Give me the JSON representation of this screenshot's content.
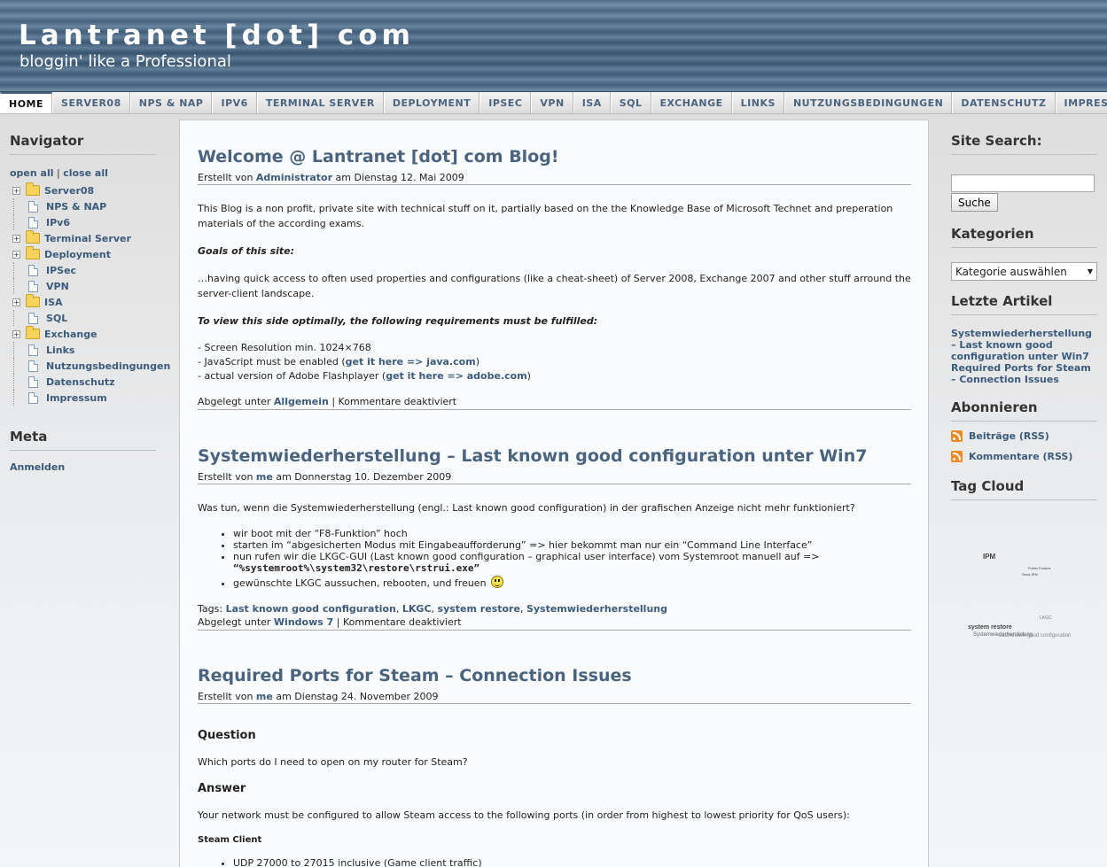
{
  "header": {
    "title": "Lantranet [dot] com",
    "tagline": "bloggin' like a Professional"
  },
  "nav": {
    "items": [
      "Home",
      "Server08",
      "NPS & NAP",
      "IPv6",
      "Terminal Server",
      "Deployment",
      "IPSec",
      "VPN",
      "ISA",
      "SQL",
      "Exchange",
      "Links",
      "Nutzungsbedingungen",
      "Datenschutz",
      "Impressum"
    ]
  },
  "left_sidebar": {
    "navigator_title": "Navigator",
    "open_all": "open all",
    "separator": "|",
    "close_all": "close all",
    "tree": [
      {
        "label": "Server08",
        "type": "folder"
      },
      {
        "label": "NPS & NAP",
        "type": "page"
      },
      {
        "label": "IPv6",
        "type": "page"
      },
      {
        "label": "Terminal Server",
        "type": "folder"
      },
      {
        "label": "Deployment",
        "type": "folder"
      },
      {
        "label": "IPSec",
        "type": "page"
      },
      {
        "label": "VPN",
        "type": "page"
      },
      {
        "label": "ISA",
        "type": "folder"
      },
      {
        "label": "SQL",
        "type": "page"
      },
      {
        "label": "Exchange",
        "type": "folder"
      },
      {
        "label": "Links",
        "type": "page"
      },
      {
        "label": "Nutzungsbedingungen",
        "type": "page"
      },
      {
        "label": "Datenschutz",
        "type": "page"
      },
      {
        "label": "Impressum",
        "type": "page"
      }
    ],
    "expander_symbol": "+",
    "meta_title": "Meta",
    "login": "Anmelden"
  },
  "posts": {
    "p1": {
      "title": "Welcome @ Lantranet [dot] com Blog!",
      "meta_prefix": "Erstellt von ",
      "author": "Administrator",
      "meta_suffix": " am Dienstag 12. Mai 2009",
      "intro": "This Blog is a non profit, private site with technical stuff on it, partially based on the the Knowledge Base of Microsoft Technet and preperation materials of the according exams.",
      "goals_heading": "Goals of this site:",
      "goals_text": "…having quick access to often used properties and configurations (like a cheat-sheet) of Server 2008, Exchange 2007 and other stuff arround the server-client landscape.",
      "req_heading": "To view this side optimally, the following requirements must be fulfilled:",
      "req1": "- Screen Resolution min. 1024×768",
      "req2_prefix": "- JavaScript must be enabled (",
      "req2_link": "get it here => java.com",
      "req2_suffix": ")",
      "req3_prefix": "- actual version of Adobe Flashplayer (",
      "req3_link": "get it here => adobe.com",
      "req3_suffix": ")",
      "filed_prefix": "Abgelegt unter ",
      "category": "Allgemein",
      "comments": " | Kommentare deaktiviert"
    },
    "p2": {
      "title": "Systemwiederherstellung – Last known good configuration unter Win7",
      "meta_prefix": "Erstellt von ",
      "author": "me",
      "meta_suffix": " am Donnerstag 10. Dezember 2009",
      "intro": "Was tun, wenn die Systemwiederherstellung (engl.: Last known good configuration) in der grafischen Anzeige nicht mehr funktioniert?",
      "li1": "wir boot mit der “F8-Funktion” hoch",
      "li2": "starten im “abgesicherten Modus mit Eingabeaufforderung” => hier bekommt man nur ein “Command Line Interface”",
      "li3_a": "nun rufen wir die LKGC-GUI (Last known good configuration – graphical user interface) vom Systemroot manuell auf =>",
      "li3_b": "“%systemroot%\\system32\\restore\\rstrui.exe”",
      "li4": "gewünschte LKGC aussuchen, rebooten, und freuen",
      "tags_prefix": "Tags: ",
      "tags": [
        "Last known good configuration",
        "LKGC",
        "system restore",
        "Systemwiederherstellung"
      ],
      "tag_sep": ", ",
      "filed_prefix": "Abgelegt unter ",
      "category": "Windows 7",
      "comments": " | Kommentare deaktiviert"
    },
    "p3": {
      "title": "Required Ports for Steam – Connection Issues",
      "meta_prefix": "Erstellt von ",
      "author": "me",
      "meta_suffix": " am Dienstag 24. November 2009",
      "question_heading": "Question",
      "question": "Which ports do I need to open on my router for Steam?",
      "answer_heading": "Answer",
      "answer": "Your network must be configured to allow Steam access to the following ports (in order from highest to lowest priority for QoS users):",
      "client_heading": "Steam Client",
      "client_li1": "UDP 27000 to 27015 inclusive (Game client traffic)"
    }
  },
  "right_sidebar": {
    "search_title": "Site Search:",
    "search_value": "",
    "search_button": "Suche",
    "categories_title": "Kategorien",
    "category_selected": "Kategorie auswählen",
    "recent_title": "Letzte Artikel",
    "recent": [
      "Systemwiederherstellung – Last known good configuration unter Win7",
      "Required Ports for Steam – Connection Issues"
    ],
    "subscribe_title": "Abonnieren",
    "rss_posts": "Beiträge (RSS)",
    "rss_comments": "Kommentare (RSS)",
    "tagcloud_title": "Tag Cloud",
    "tagcloud": {
      "t1": "IPM",
      "t2": "Public Folders",
      "t3": "Send-IPM",
      "t4": "LKGC",
      "t5": "system restore",
      "t6": "Systemwiederherstellung",
      "t7": "Last known good configuration"
    }
  }
}
